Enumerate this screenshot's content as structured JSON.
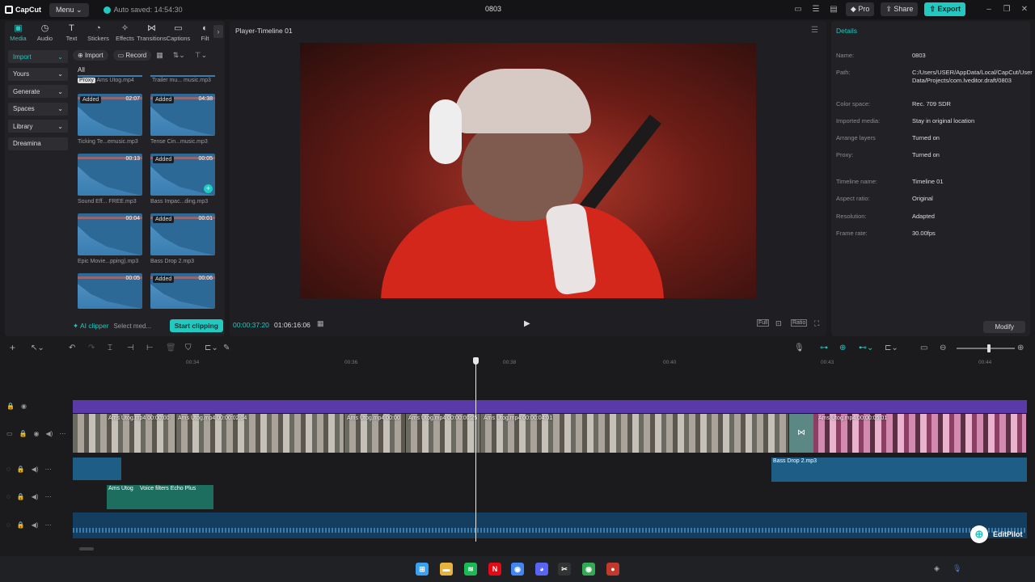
{
  "app": {
    "logo": "CapCut",
    "menu_label": "Menu",
    "autosave": "Auto saved: 14:54:30",
    "project_title": "0803",
    "pro_label": "Pro",
    "share_label": "Share",
    "export_label": "Export"
  },
  "tools": [
    {
      "label": "Media",
      "icon": "media-icon",
      "glyph": "▣"
    },
    {
      "label": "Audio",
      "icon": "audio-icon",
      "glyph": "◷"
    },
    {
      "label": "Text",
      "icon": "text-icon",
      "glyph": "T"
    },
    {
      "label": "Stickers",
      "icon": "stickers-icon",
      "glyph": "◔"
    },
    {
      "label": "Effects",
      "icon": "effects-icon",
      "glyph": "✧"
    },
    {
      "label": "Transitions",
      "icon": "transitions-icon",
      "glyph": "⋈"
    },
    {
      "label": "Captions",
      "icon": "captions-icon",
      "glyph": "▭"
    },
    {
      "label": "Filt",
      "icon": "filters-icon",
      "glyph": "◐"
    }
  ],
  "sidebar": [
    {
      "label": "Import",
      "active": true,
      "chevron": "⌄"
    },
    {
      "label": "Yours",
      "active": false,
      "chevron": "⌄"
    },
    {
      "label": "Generate",
      "active": false,
      "chevron": "⌄"
    },
    {
      "label": "Spaces",
      "active": false,
      "chevron": "⌄"
    },
    {
      "label": "Library",
      "active": false,
      "chevron": "⌄"
    },
    {
      "label": "Dreamina",
      "active": false,
      "chevron": ""
    }
  ],
  "media": {
    "import_btn": "Import",
    "record_btn": "Record",
    "all_label": "All",
    "proxy_tag": "Proxy",
    "top_items": [
      "Ams Utog.mp4",
      "Trailer mu... music.mp3"
    ],
    "tiles": [
      {
        "name": "Ticking Te...emusic.mp3",
        "duration": "02:07",
        "added": "Added"
      },
      {
        "name": "Tense Cin...music.mp3",
        "duration": "04:38",
        "added": "Added"
      },
      {
        "name": "Sound Eff... FREE.mp3",
        "duration": "00:13",
        "added": ""
      },
      {
        "name": "Bass Impac...ding.mp3",
        "duration": "00:05",
        "added": "Added"
      },
      {
        "name": "Epic Movie...pping).mp3",
        "duration": "00:04",
        "added": ""
      },
      {
        "name": "Bass Drop 2.mp3",
        "duration": "00:01",
        "added": "Added"
      },
      {
        "name": "",
        "duration": "00:05",
        "added": ""
      },
      {
        "name": "",
        "duration": "00:06",
        "added": "Added"
      }
    ],
    "ai_clipper": "AI clipper",
    "select_media": "Select med...",
    "start_clipping": "Start clipping",
    "try_free": "Try free"
  },
  "player": {
    "title": "Player-Timeline 01",
    "current_time": "00:00:37:20",
    "total_time": "01:06:16:06",
    "full_label": "Full",
    "ratio_label": "Ratio"
  },
  "details": {
    "title": "Details",
    "rows": [
      {
        "key": "Name:",
        "value": "0803"
      },
      {
        "key": "Path:",
        "value": "C:/Users/USER/AppData/Local/CapCut/User Data/Projects/com.lveditor.draft/0803"
      },
      {
        "key": "Color space:",
        "value": "Rec. 709 SDR"
      },
      {
        "key": "Imported media:",
        "value": "Stay in original location"
      },
      {
        "key": "Arrange layers",
        "value": "Turned on"
      },
      {
        "key": "Proxy:",
        "value": "Turned on"
      },
      {
        "key": "Timeline name:",
        "value": "Timeline 01"
      },
      {
        "key": "Aspect ratio:",
        "value": "Original"
      },
      {
        "key": "Resolution:",
        "value": "Adapted"
      },
      {
        "key": "Frame rate:",
        "value": "30.00fps"
      }
    ],
    "modify_btn": "Modify"
  },
  "timeline": {
    "ticks": [
      "00:34",
      "00:36",
      "00:38",
      "00:40",
      "00:43",
      "00:44"
    ],
    "video_labels": [
      "Ams Utog.mp4  00:00:00",
      "Ams Utog.mp4  00:00:02:04",
      "Ams Utog.mp4  00:00",
      "Ams Utog.mp4  00:00:00:25",
      "Ams Utog.mp4  00:00:04:01",
      "Ams Utog.mp4  00:00:05:01"
    ],
    "audio_label_bass": "Bass Drop 2.mp3",
    "audio_label_echo_name": "Ams Utog",
    "audio_label_echo_filter": "Voice filters Echo Plus",
    "editpilot": "EditPilot"
  },
  "taskbar": [
    {
      "icon": "windows-start-icon",
      "glyph": "⊞",
      "color": "#3aa0f0"
    },
    {
      "icon": "file-explorer-icon",
      "glyph": "▬",
      "color": "#e8b33a"
    },
    {
      "icon": "spotify-icon",
      "glyph": "≋",
      "color": "#1db954"
    },
    {
      "icon": "netflix-icon",
      "glyph": "N",
      "color": "#e50914"
    },
    {
      "icon": "chrome-icon",
      "glyph": "◉",
      "color": "#4285f4"
    },
    {
      "icon": "discord-icon",
      "glyph": "◕",
      "color": "#5865f2"
    },
    {
      "icon": "capcut-icon",
      "glyph": "✂",
      "color": "#333"
    },
    {
      "icon": "chrome-profile-icon",
      "glyph": "◉",
      "color": "#34a853"
    },
    {
      "icon": "app-icon",
      "glyph": "●",
      "color": "#c0392b"
    }
  ]
}
